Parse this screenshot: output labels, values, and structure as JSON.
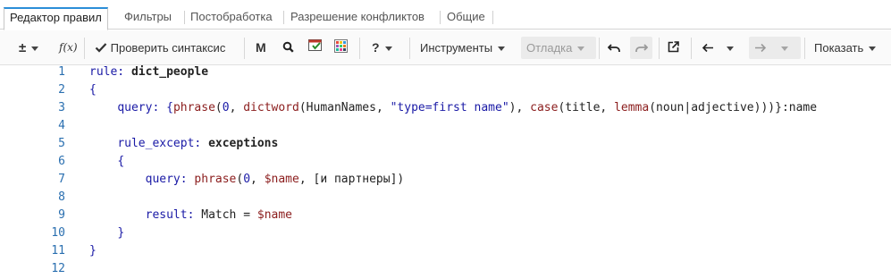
{
  "tabs": [
    {
      "label": "Редактор правил",
      "active": true
    },
    {
      "label": "Фильтры",
      "active": false
    },
    {
      "label": "Постобработка",
      "active": false
    },
    {
      "label": "Разрешение конфликтов",
      "active": false
    },
    {
      "label": "Общие",
      "active": false
    }
  ],
  "toolbar": {
    "plusminus_label": "±",
    "fx_label": "f(x)",
    "check_syntax_label": "Проверить синтаксис",
    "m_label": "M",
    "help_label": "?",
    "tools_label": "Инструменты",
    "debug_label": "Отладка",
    "show_label": "Показать"
  },
  "editor": {
    "line_numbers": [
      "1",
      "2",
      "3",
      "4",
      "5",
      "6",
      "7",
      "8",
      "9",
      "10",
      "11",
      "12"
    ],
    "lines": {
      "l1_kw": "rule:",
      "l1_name": "dict_people",
      "l2": "{",
      "l3_query": "query:",
      "l3_open": "{",
      "l3_phrase": "phrase",
      "l3_p1": "(",
      "l3_zero": "0",
      "l3_comma1": ", ",
      "l3_dictword": "dictword",
      "l3_p2": "(",
      "l3_humannames": "HumanNames, ",
      "l3_str": "\"type=first name\"",
      "l3_p3": "), ",
      "l3_case": "case",
      "l3_p4": "(",
      "l3_title": "title, ",
      "l3_lemma": "lemma",
      "l3_p5": "(",
      "l3_noun": "noun",
      "l3_bar": "|",
      "l3_adj": "adjective",
      "l3_close": ")))}",
      "l3_name": ":name",
      "l5_kw": "rule_except:",
      "l5_name": "exceptions",
      "l6": "{",
      "l7_query": "query:",
      "l7_phrase": "phrase",
      "l7_p1": "(",
      "l7_zero": "0",
      "l7_comma": ", ",
      "l7_var": "$name",
      "l7_rest": ", [и партнеры])",
      "l9_result": "result:",
      "l9_match": "Match",
      "l9_eq": " = ",
      "l9_var": "$name",
      "l10": "}",
      "l11": "}"
    }
  },
  "colors": {
    "accent": "#2b8ed8",
    "keyword": "#1a1aa6",
    "function": "#8b1d1d",
    "line_number": "#2a6fb0"
  }
}
